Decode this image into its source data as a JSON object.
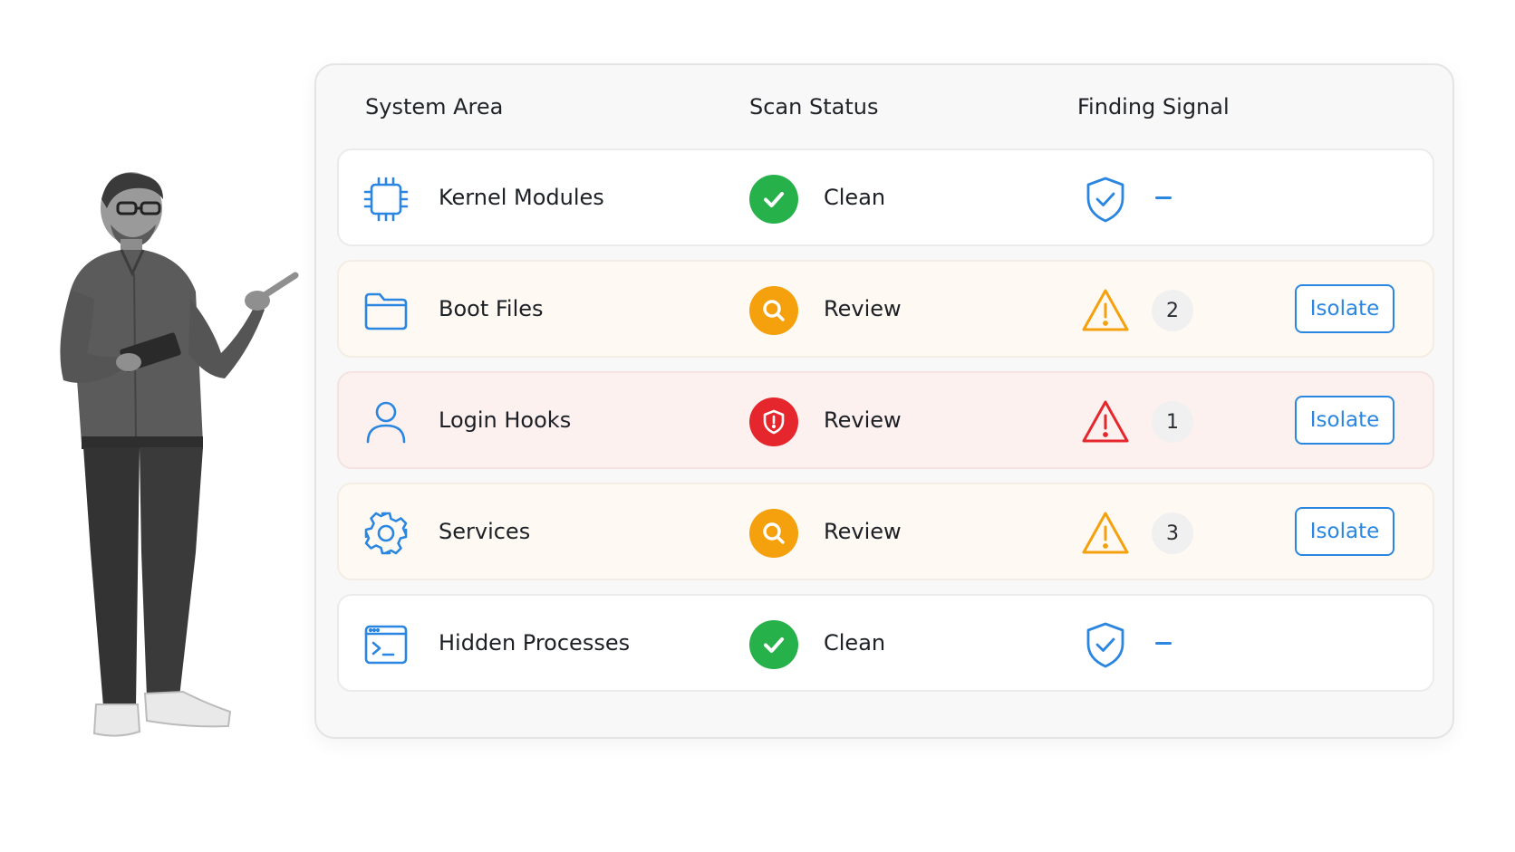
{
  "table": {
    "headers": {
      "area": "System Area",
      "status": "Scan Status",
      "signal": "Finding Signal"
    },
    "rows": [
      {
        "area": "Kernel Modules",
        "area_icon": "chip-icon",
        "status": "Clean",
        "status_icon": "check-circle-icon",
        "status_color": "#27b14b",
        "signal_icon": "shield-check-icon",
        "signal": "–",
        "count": null,
        "action": null,
        "tint": "none"
      },
      {
        "area": "Boot Files",
        "area_icon": "folder-icon",
        "status": "Review",
        "status_icon": "search-circle-icon",
        "status_color": "#f5a00d",
        "signal_icon": "warning-amber-icon",
        "signal": null,
        "count": "2",
        "action": "Isolate",
        "tint": "amber"
      },
      {
        "area": "Login Hooks",
        "area_icon": "user-icon",
        "status": "Review",
        "status_icon": "shield-alert-circle-icon",
        "status_color": "#e5262c",
        "signal_icon": "warning-red-icon",
        "signal": null,
        "count": "1",
        "action": "Isolate",
        "tint": "red"
      },
      {
        "area": "Services",
        "area_icon": "gear-icon",
        "status": "Review",
        "status_icon": "search-circle-icon",
        "status_color": "#f5a00d",
        "signal_icon": "warning-amber-icon",
        "signal": null,
        "count": "3",
        "action": "Isolate",
        "tint": "amber"
      },
      {
        "area": "Hidden Processes",
        "area_icon": "terminal-icon",
        "status": "Clean",
        "status_icon": "check-circle-icon",
        "status_color": "#27b14b",
        "signal_icon": "shield-check-icon",
        "signal": "–",
        "count": null,
        "action": null,
        "tint": "none"
      }
    ]
  },
  "colors": {
    "accent": "#2a86e0",
    "clean": "#27b14b",
    "review": "#f5a00d",
    "alert": "#e5262c"
  }
}
